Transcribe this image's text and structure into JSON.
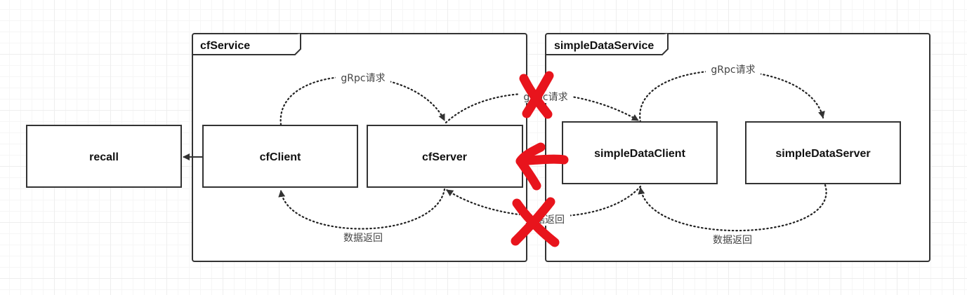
{
  "groups": {
    "cf_service": "cfService",
    "simple_data_service": "simpleDataService"
  },
  "nodes": {
    "recall": "recall",
    "cf_client": "cfClient",
    "cf_server": "cfServer",
    "simple_data_client": "simpleDataClient",
    "simple_data_server": "simpleDataServer"
  },
  "edges": {
    "cf_request": "gRpc请求",
    "cf_return": "数据返回",
    "cross_request": "gRpc请求",
    "cross_return": "数据返回",
    "sds_request": "gRpc请求",
    "sds_return": "数据返回"
  },
  "colors": {
    "line": "#333333",
    "annotation": "#e8141c"
  }
}
